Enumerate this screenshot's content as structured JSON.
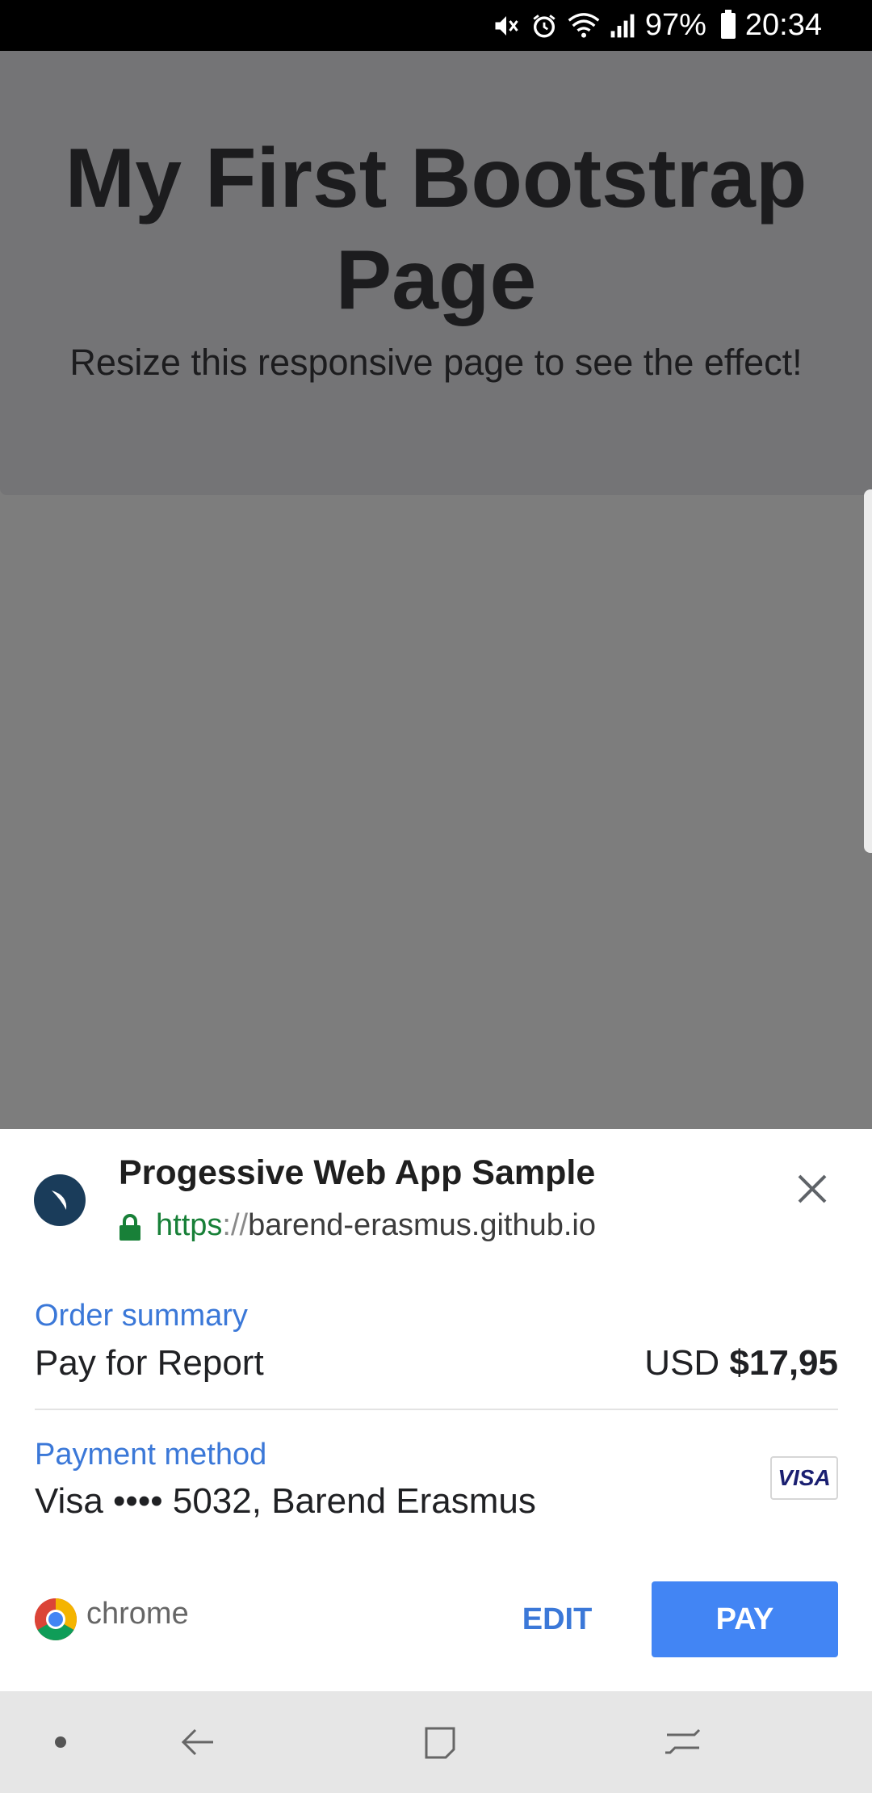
{
  "status_bar": {
    "battery": "97%",
    "time": "20:34",
    "icons": [
      "mute-icon",
      "alarm-icon",
      "wifi-icon",
      "signal-icon",
      "battery-icon"
    ]
  },
  "page": {
    "title": "My First Bootstrap Page",
    "subtitle": "Resize this responsive page to see the effect!"
  },
  "payment_sheet": {
    "merchant": {
      "title": "Progessive Web App Sample",
      "url_scheme": "https",
      "url_sep": "://",
      "url_host": "barend-erasmus.github.io"
    },
    "order_summary": {
      "label": "Order summary",
      "item": "Pay for Report",
      "currency": "USD",
      "amount": "$17,95"
    },
    "payment_method": {
      "label": "Payment method",
      "value": "Visa  •••• 5032, Barend Erasmus",
      "card_brand": "VISA"
    },
    "footer": {
      "brand": "chrome",
      "edit_label": "EDIT",
      "pay_label": "PAY"
    },
    "colors": {
      "accent": "#3b78d8",
      "pay_button": "#4285f4",
      "url_green": "#188038"
    }
  },
  "nav_bar": {
    "items": [
      "dot-icon",
      "back-icon",
      "home-icon",
      "recents-icon"
    ]
  }
}
